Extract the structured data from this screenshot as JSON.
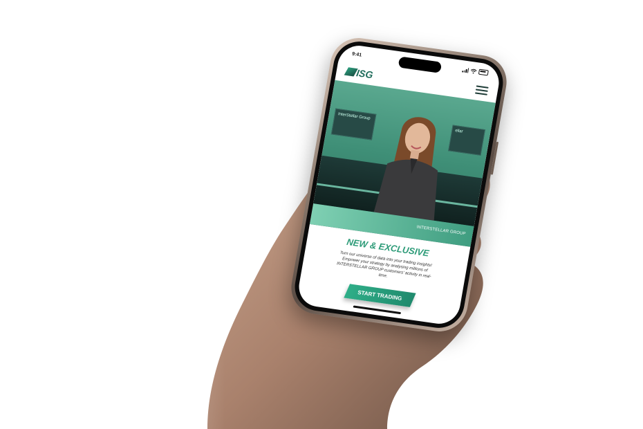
{
  "status_bar": {
    "time": "9:41"
  },
  "header": {
    "logo_text": "ISG",
    "menu_icon": "hamburger-menu-icon"
  },
  "hero": {
    "panel_text_left": "InterStellar Group",
    "panel_text_right": "ellar",
    "caption": "INTERSTELLAR GROUP"
  },
  "content": {
    "headline": "NEW & EXCLUSIVE",
    "body": "Turn our universe of data into your trading insights! Empower your strategy by analysing millions of INTERSTELLAR GROUP customers' activity in real-time.",
    "cta_label": "START TRADING"
  },
  "colors": {
    "brand_green": "#2d9b78",
    "cta_green": "#2fae88",
    "hero_green": "#3f8f77"
  }
}
